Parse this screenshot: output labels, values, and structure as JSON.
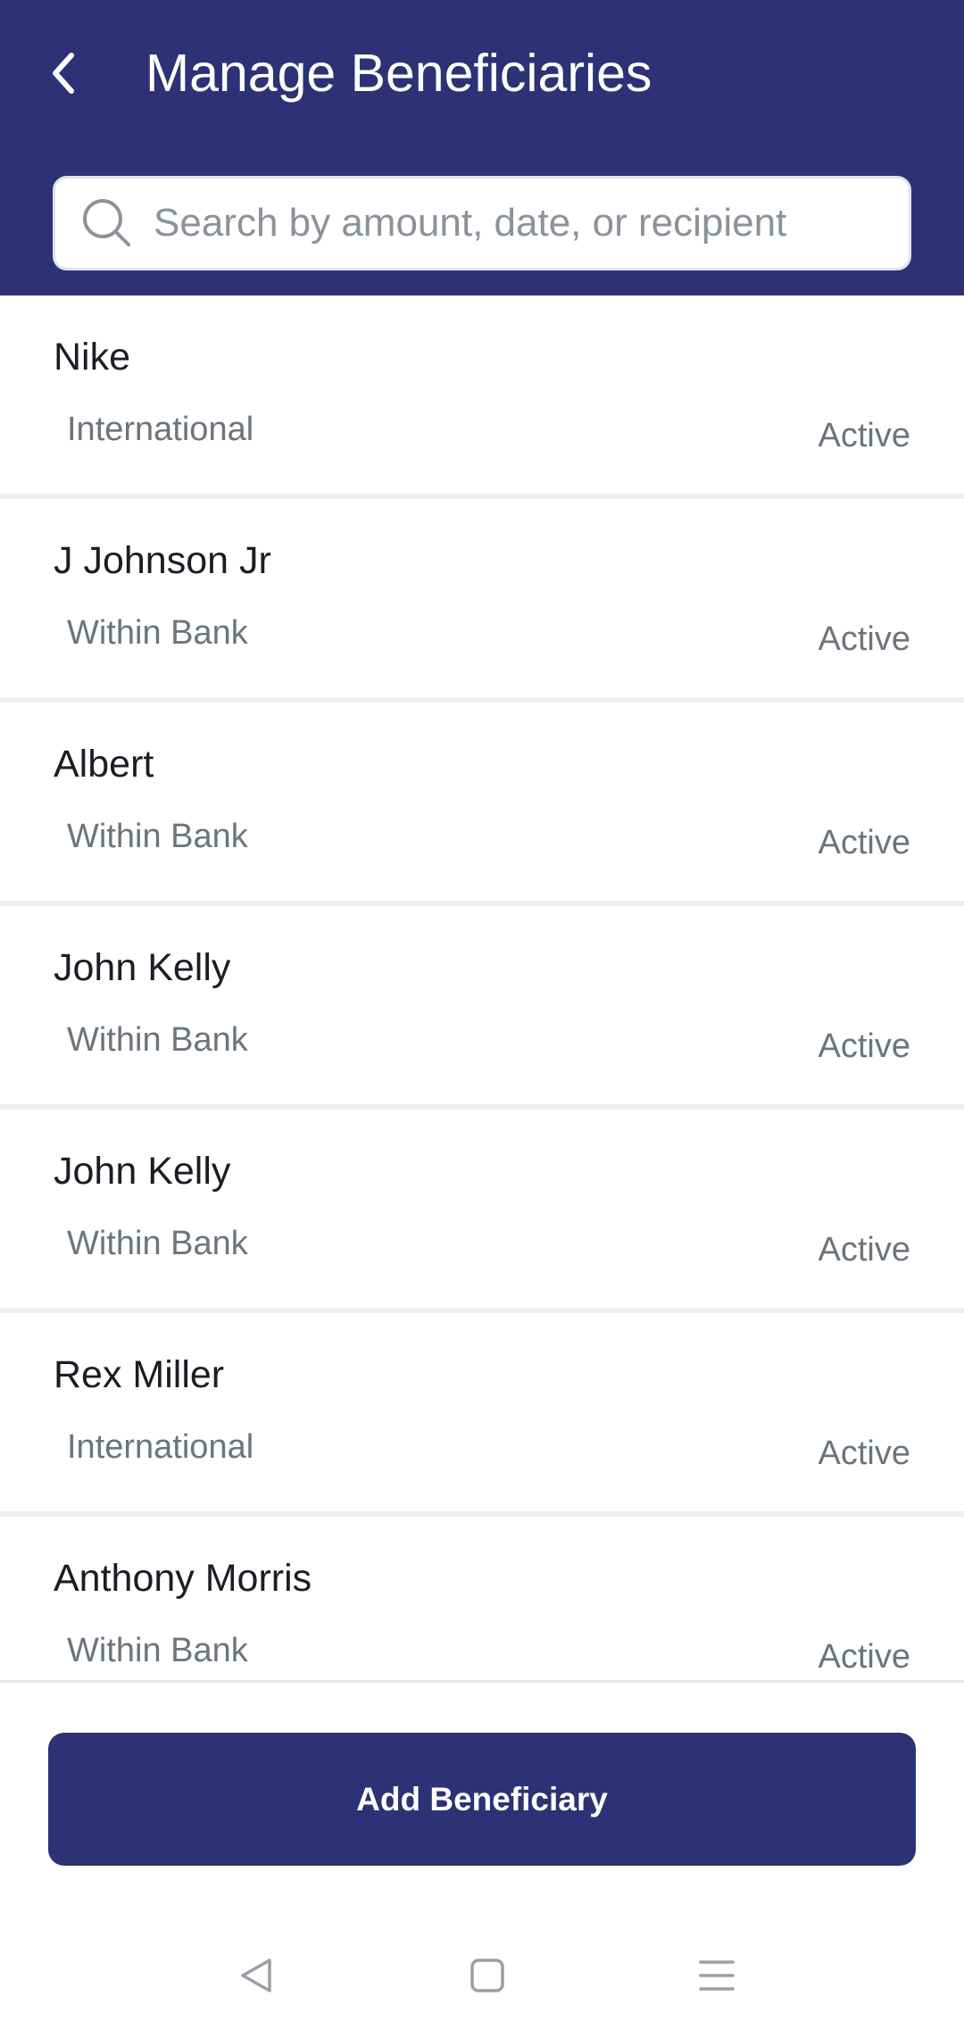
{
  "header": {
    "title": "Manage Beneficiaries",
    "back_icon": "chevron-left-icon",
    "background": "#2c3275"
  },
  "search": {
    "placeholder": "Search by amount, date, or recipient",
    "value": "",
    "icon": "search-icon"
  },
  "beneficiaries": [
    {
      "name": "Nike",
      "type": "International",
      "status": "Active"
    },
    {
      "name": "J Johnson Jr",
      "type": "Within Bank",
      "status": "Active"
    },
    {
      "name": "Albert",
      "type": "Within Bank",
      "status": "Active"
    },
    {
      "name": "John Kelly",
      "type": "Within Bank",
      "status": "Active"
    },
    {
      "name": "John Kelly",
      "type": "Within Bank",
      "status": "Active"
    },
    {
      "name": "Rex Miller",
      "type": "International",
      "status": "Active"
    },
    {
      "name": "Anthony Morris",
      "type": "Within Bank",
      "status": "Active"
    }
  ],
  "actions": {
    "add_label": "Add Beneficiary",
    "accent": "#2c3275"
  },
  "system_nav": {
    "back_icon": "triangle-back-icon",
    "home_icon": "square-home-icon",
    "menu_icon": "hamburger-menu-icon"
  }
}
